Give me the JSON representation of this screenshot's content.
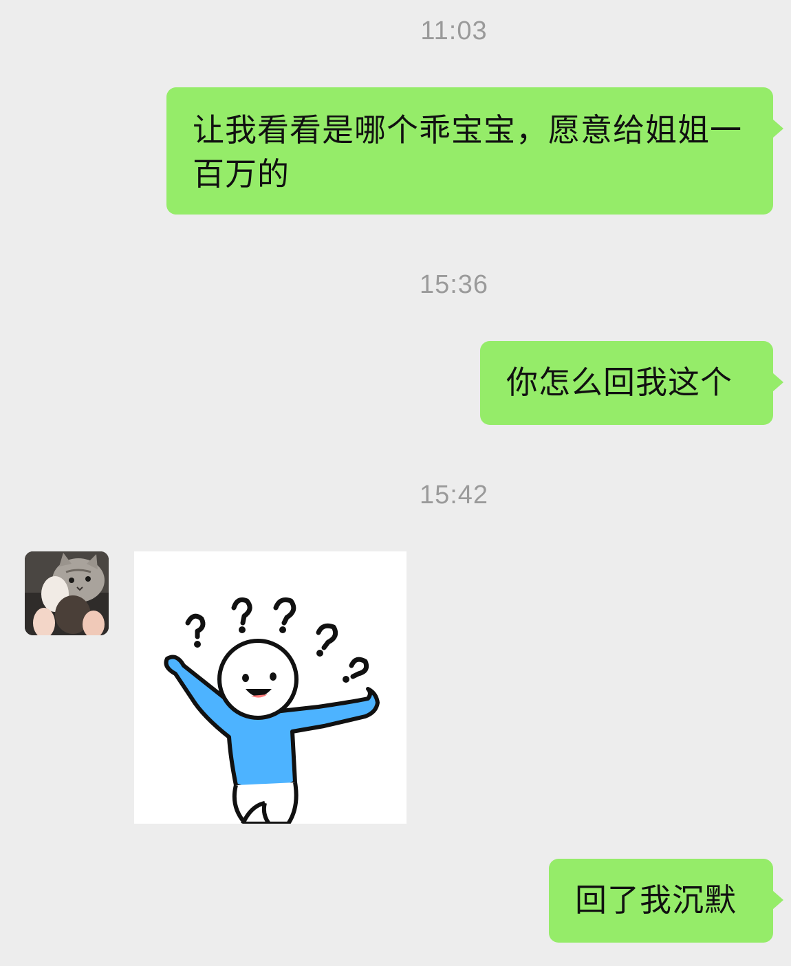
{
  "messages": [
    {
      "type": "time",
      "text": "11:03"
    },
    {
      "type": "text",
      "side": "right",
      "text": "让我看看是哪个乖宝宝，愿意给姐姐一百万的"
    },
    {
      "type": "time",
      "text": "15:36"
    },
    {
      "type": "text",
      "side": "right",
      "text": "你怎么回我这个"
    },
    {
      "type": "time",
      "text": "15:42"
    },
    {
      "type": "sticker",
      "side": "left",
      "avatar": "cat-avatar",
      "sticker": "confused-stick-figure-sticker"
    },
    {
      "type": "text",
      "side": "right",
      "text": "回了我沉默"
    }
  ],
  "colors": {
    "background": "#ededed",
    "outgoing_bubble": "#95ec69",
    "timestamp": "#9a9a9a",
    "sticker_shirt": "#4db3ff"
  }
}
